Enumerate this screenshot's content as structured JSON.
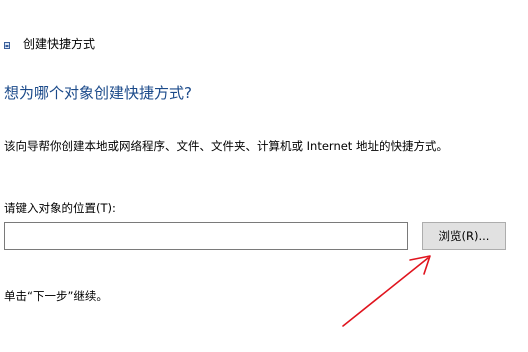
{
  "wizard": {
    "title": "创建快捷方式",
    "heading": "想为哪个对象创建快捷方式?",
    "description": "该向导帮你创建本地或网络程序、文件、文件夹、计算机或 Internet 地址的快捷方式。",
    "location_label": "请键入对象的位置(T):",
    "location_value": "",
    "browse_label": "浏览(R)...",
    "hint": "单击“下一步”继续。"
  },
  "icons": {
    "wizard_icon": "shortcut-wizard-icon"
  },
  "colors": {
    "heading": "#1b4a8a",
    "annotation_arrow": "#e0141e",
    "button_background": "#e1e1e1",
    "input_border": "#7a7a7a"
  }
}
